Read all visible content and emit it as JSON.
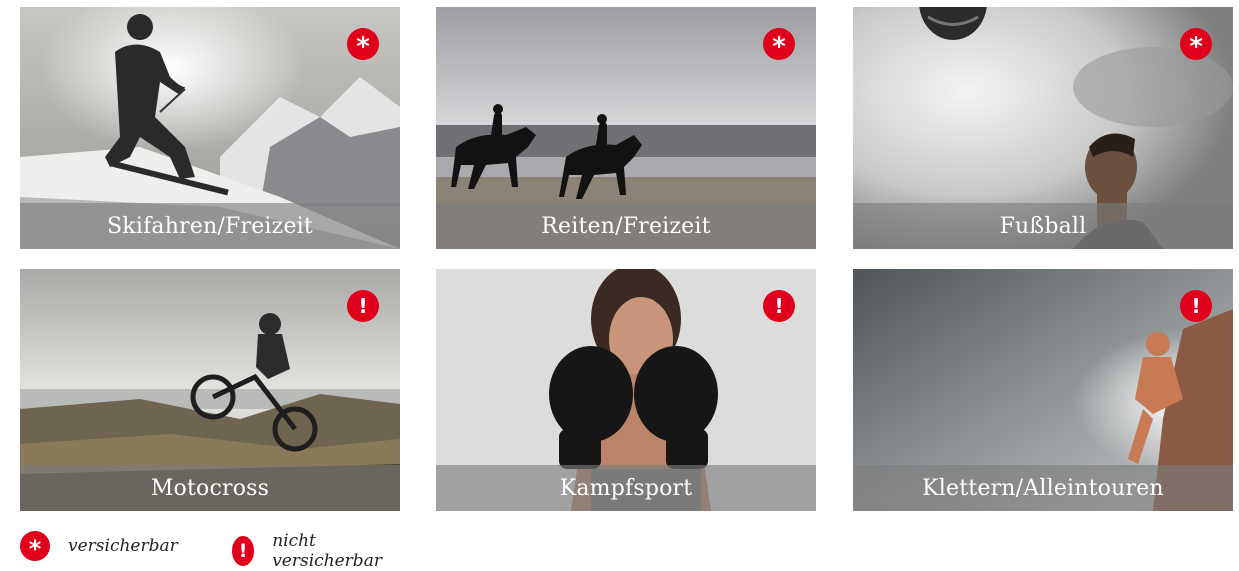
{
  "tiles": [
    {
      "caption": "Skifahren/Freizeit",
      "badge": "*",
      "status": "versicherbar"
    },
    {
      "caption": "Reiten/Freizeit",
      "badge": "*",
      "status": "versicherbar"
    },
    {
      "caption": "Fußball",
      "badge": "*",
      "status": "versicherbar"
    },
    {
      "caption": "Motocross",
      "badge": "!",
      "status": "nicht versicherbar"
    },
    {
      "caption": "Kampfsport",
      "badge": "!",
      "status": "nicht versicherbar"
    },
    {
      "caption": "Klettern/Alleintouren",
      "badge": "!",
      "status": "nicht versicherbar"
    }
  ],
  "legend": {
    "insurable_symbol": "*",
    "insurable_label": "versicherbar",
    "not_insurable_symbol": "!",
    "not_insurable_label": "nicht versicherbar"
  },
  "colors": {
    "badge": "#e0001b",
    "caption_overlay": "#7d7d7d"
  }
}
